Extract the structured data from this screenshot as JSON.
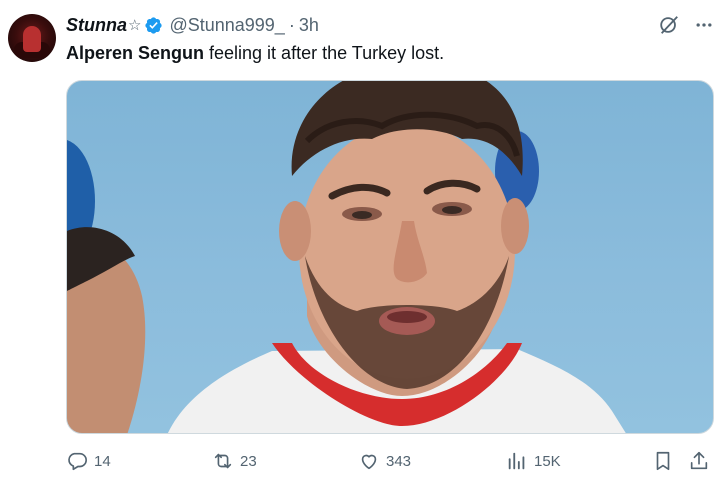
{
  "tweet": {
    "display_name": "Stunna",
    "name_symbol": "☆",
    "handle": "@Stunna999_",
    "separator": "·",
    "time": "3h",
    "text_bold": "Alperen Sengun",
    "text_rest": " feeling it after the Turkey lost."
  },
  "icons": {
    "verified": "verified-badge-icon",
    "grok": "grok-icon",
    "more": "more-icon",
    "reply": "reply-icon",
    "retweet": "retweet-icon",
    "like": "like-icon",
    "views": "views-icon",
    "bookmark": "bookmark-icon",
    "share": "share-icon"
  },
  "metrics": {
    "replies": "14",
    "retweets": "23",
    "likes": "343",
    "views": "15K"
  },
  "colors": {
    "verified_blue": "#1d9bf0",
    "secondary_text": "#536471",
    "primary_text": "#0f1419"
  }
}
